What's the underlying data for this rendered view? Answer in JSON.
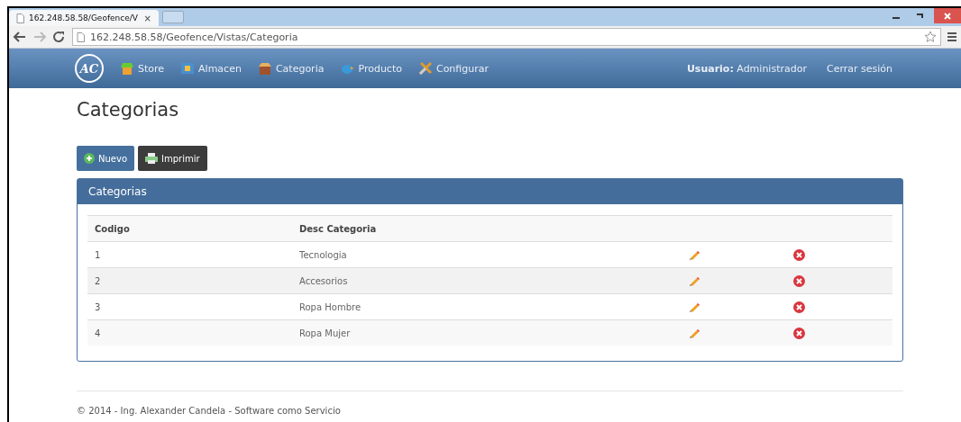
{
  "browser": {
    "tab_title": "162.248.58.58/Geofence/V",
    "tab_close": "×",
    "url": "162.248.58.58/Geofence/Vistas/Categoria"
  },
  "navbar": {
    "logo": "AC",
    "items": [
      {
        "label": "Store"
      },
      {
        "label": "Almacen"
      },
      {
        "label": "Categoria"
      },
      {
        "label": "Producto"
      },
      {
        "label": "Configurar"
      }
    ],
    "user_label": "Usuario:",
    "user_name": "Administrador",
    "logout": "Cerrar sesión"
  },
  "page_title": "Categorias",
  "buttons": [
    {
      "label": "Nuevo",
      "kind": "new"
    },
    {
      "label": "Imprimir",
      "kind": "print"
    }
  ],
  "panel": {
    "title": "Categorias",
    "columns": [
      "Codigo",
      "Desc Categoria"
    ],
    "rows": [
      {
        "code": "1",
        "name": "Tecnologia"
      },
      {
        "code": "2",
        "name": "Accesorios"
      },
      {
        "code": "3",
        "name": "Ropa Hombre"
      },
      {
        "code": "4",
        "name": "Ropa Mujer"
      }
    ]
  },
  "footer": "© 2014 - Ing. Alexander Candela - Software como Servicio"
}
